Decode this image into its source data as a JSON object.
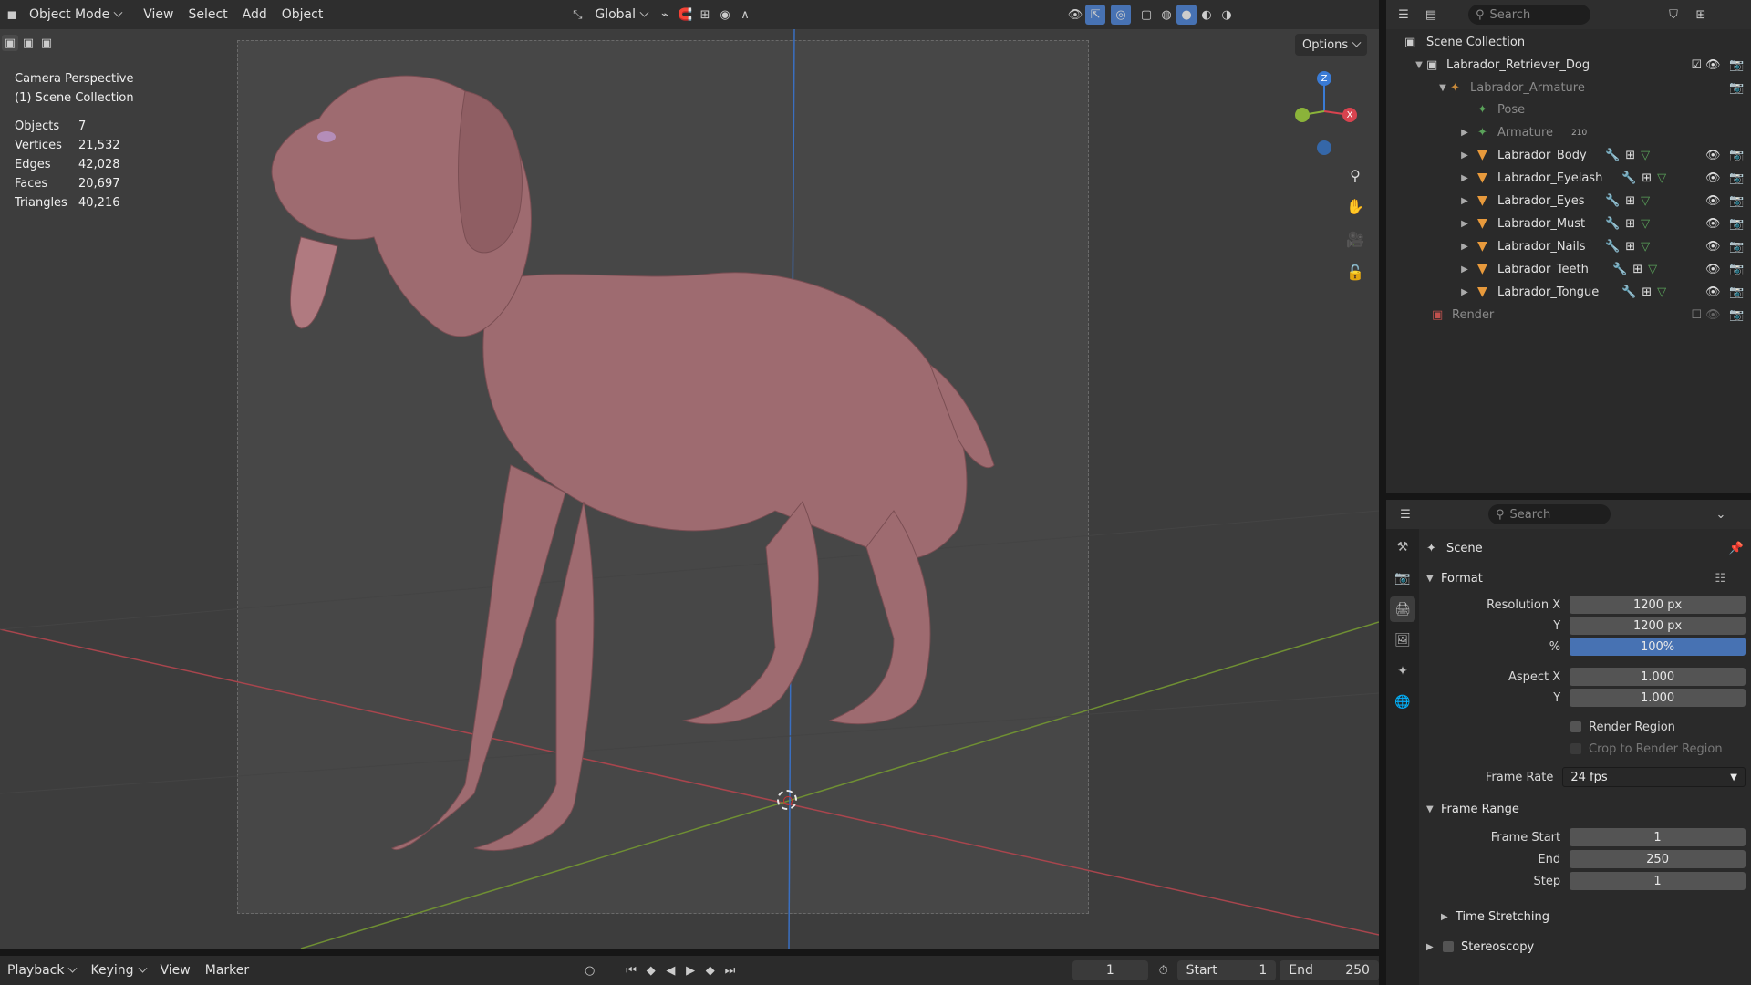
{
  "header": {
    "mode": "Object Mode",
    "menus": [
      "View",
      "Select",
      "Add",
      "Object"
    ],
    "orientation": "Global",
    "options": "Options"
  },
  "viewport": {
    "camera_label": "Camera Perspective",
    "collection_label": "(1) Scene Collection",
    "stats": [
      {
        "k": "Objects",
        "v": "7"
      },
      {
        "k": "Vertices",
        "v": "21,532"
      },
      {
        "k": "Edges",
        "v": "42,028"
      },
      {
        "k": "Faces",
        "v": "20,697"
      },
      {
        "k": "Triangles",
        "v": "40,216"
      }
    ],
    "gizmo": {
      "z": "Z",
      "x": "X"
    }
  },
  "timeline": {
    "menus": [
      "Playback",
      "Keying",
      "View",
      "Marker"
    ],
    "current_frame": "1",
    "start_label": "Start",
    "start": "1",
    "end_label": "End",
    "end": "250"
  },
  "outliner": {
    "search_placeholder": "Search",
    "scene_collection": "Scene Collection",
    "collection": "Labrador_Retriever_Dog",
    "armature": "Labrador_Armature",
    "pose": "Pose",
    "armature_data": "Armature",
    "armature_count": "210",
    "objects": [
      "Labrador_Body",
      "Labrador_Eyelash",
      "Labrador_Eyes",
      "Labrador_Must",
      "Labrador_Nails",
      "Labrador_Teeth",
      "Labrador_Tongue"
    ],
    "render": "Render"
  },
  "properties": {
    "search_placeholder": "Search",
    "context": "Scene",
    "format_title": "Format",
    "resolution_x_label": "Resolution X",
    "resolution_x": "1200 px",
    "y_label": "Y",
    "resolution_y": "1200 px",
    "percent_label": "%",
    "percent": "100%",
    "aspect_x_label": "Aspect X",
    "aspect_x": "1.000",
    "aspect_y": "1.000",
    "render_region": "Render Region",
    "crop_region": "Crop to Render Region",
    "frame_rate_label": "Frame Rate",
    "frame_rate": "24 fps",
    "frame_range_title": "Frame Range",
    "frame_start_label": "Frame Start",
    "frame_start": "1",
    "end_label": "End",
    "frame_end": "250",
    "step_label": "Step",
    "step": "1",
    "time_stretching": "Time Stretching",
    "stereoscopy": "Stereoscopy"
  }
}
